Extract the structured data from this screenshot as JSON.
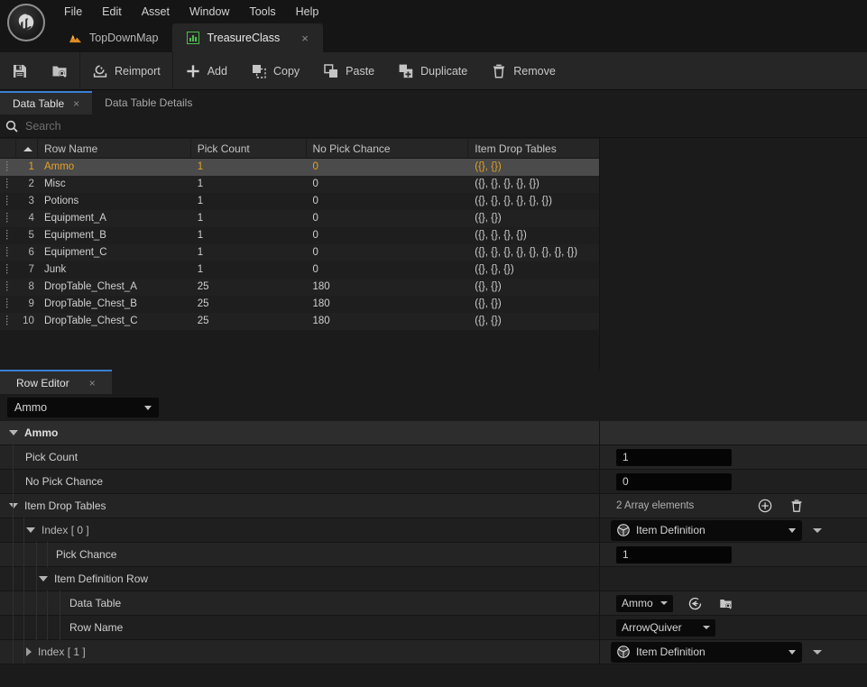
{
  "window": {
    "logo_icon": "unreal-engine-logo"
  },
  "menubar": {
    "items": [
      {
        "label": "File"
      },
      {
        "label": "Edit"
      },
      {
        "label": "Asset"
      },
      {
        "label": "Window"
      },
      {
        "label": "Tools"
      },
      {
        "label": "Help"
      }
    ]
  },
  "asset_tabs": [
    {
      "label": "TopDownMap",
      "icon": "level-icon",
      "active": false,
      "closable": false
    },
    {
      "label": "TreasureClass",
      "icon": "data-table-icon",
      "active": true,
      "closable": true,
      "close_label": "×"
    }
  ],
  "toolbar": {
    "save_label": "",
    "save_icon": "save-icon",
    "browse_icon": "browse-content-icon",
    "buttons": [
      {
        "label": "Reimport",
        "icon": "reimport-icon"
      },
      {
        "label": "Add",
        "icon": "add-icon"
      },
      {
        "label": "Copy",
        "icon": "copy-icon"
      },
      {
        "label": "Paste",
        "icon": "paste-icon"
      },
      {
        "label": "Duplicate",
        "icon": "duplicate-icon"
      },
      {
        "label": "Remove",
        "icon": "remove-icon"
      }
    ]
  },
  "data_table_panel": {
    "tabs": [
      {
        "label": "Data Table",
        "active": true,
        "close_label": "×"
      },
      {
        "label": "Data Table Details",
        "active": false
      }
    ],
    "search": {
      "placeholder": "Search",
      "value": "",
      "icon": "search-icon"
    },
    "columns": [
      {
        "key": "row_name",
        "label": "Row Name"
      },
      {
        "key": "pick_count",
        "label": "Pick Count"
      },
      {
        "key": "no_pick_chance",
        "label": "No Pick Chance"
      },
      {
        "key": "item_drop_tables",
        "label": "Item Drop Tables"
      }
    ],
    "sort_indicator": "ascending",
    "rows": [
      {
        "num": "1",
        "row_name": "Ammo",
        "pick_count": "1",
        "no_pick_chance": "0",
        "item_drop_tables": "({}, {})",
        "selected": true
      },
      {
        "num": "2",
        "row_name": "Misc",
        "pick_count": "1",
        "no_pick_chance": "0",
        "item_drop_tables": "({}, {}, {}, {}, {})",
        "selected": false
      },
      {
        "num": "3",
        "row_name": "Potions",
        "pick_count": "1",
        "no_pick_chance": "0",
        "item_drop_tables": "({}, {}, {}, {}, {}, {})",
        "selected": false
      },
      {
        "num": "4",
        "row_name": "Equipment_A",
        "pick_count": "1",
        "no_pick_chance": "0",
        "item_drop_tables": "({}, {})",
        "selected": false
      },
      {
        "num": "5",
        "row_name": "Equipment_B",
        "pick_count": "1",
        "no_pick_chance": "0",
        "item_drop_tables": "({}, {}, {}, {})",
        "selected": false
      },
      {
        "num": "6",
        "row_name": "Equipment_C",
        "pick_count": "1",
        "no_pick_chance": "0",
        "item_drop_tables": "({}, {}, {}, {}, {}, {}, {}, {})",
        "selected": false
      },
      {
        "num": "7",
        "row_name": "Junk",
        "pick_count": "1",
        "no_pick_chance": "0",
        "item_drop_tables": "({}, {}, {})",
        "selected": false
      },
      {
        "num": "8",
        "row_name": "DropTable_Chest_A",
        "pick_count": "25",
        "no_pick_chance": "180",
        "item_drop_tables": "({}, {})",
        "selected": false
      },
      {
        "num": "9",
        "row_name": "DropTable_Chest_B",
        "pick_count": "25",
        "no_pick_chance": "180",
        "item_drop_tables": "({}, {})",
        "selected": false
      },
      {
        "num": "10",
        "row_name": "DropTable_Chest_C",
        "pick_count": "25",
        "no_pick_chance": "180",
        "item_drop_tables": "({}, {})",
        "selected": false
      }
    ]
  },
  "row_editor": {
    "tab": {
      "label": "Row Editor",
      "close_label": "×"
    },
    "row_selector": {
      "value": "Ammo"
    },
    "category": {
      "label": "Ammo"
    },
    "properties": {
      "pick_count": {
        "label": "Pick Count",
        "value": "1"
      },
      "no_pick_chance": {
        "label": "No Pick Chance",
        "value": "0"
      },
      "item_drop_tables": {
        "label": "Item Drop Tables",
        "array_count_text": "2 Array elements",
        "add_icon": "add-element-icon",
        "clear_icon": "delete-all-icon"
      },
      "index_0": {
        "label": "Index [ 0 ]",
        "object_value": "Item Definition",
        "object_icon": "struct-icon",
        "pick_chance": {
          "label": "Pick Chance",
          "value": "1"
        },
        "item_definition_row": {
          "label": "Item Definition Row",
          "data_table": {
            "label": "Data Table",
            "value": "Ammo",
            "browse_icon": "browse-asset-icon",
            "use_selected_icon": "use-selected-asset-icon"
          },
          "row_name": {
            "label": "Row Name",
            "value": "ArrowQuiver"
          }
        }
      },
      "index_1": {
        "label": "Index [ 1 ]",
        "object_value": "Item Definition",
        "object_icon": "struct-icon"
      }
    }
  },
  "colors": {
    "selection_text": "#e5a227",
    "selection_bg": "#4b4b4b",
    "active_tab_underline": "#3a7fd4",
    "panel_bg": "#1b1b1b",
    "toolbar_bg": "#262626",
    "datatable_icon": "#4bbf4b",
    "level_icon": "#e08a20"
  }
}
